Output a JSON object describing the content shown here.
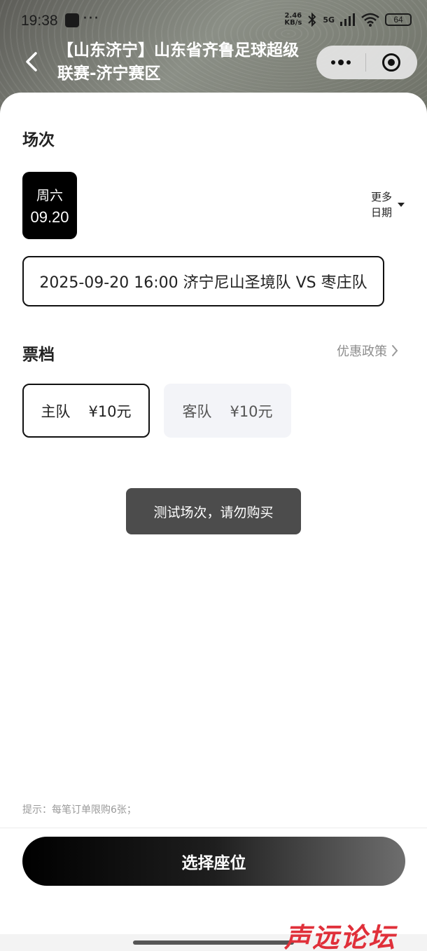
{
  "status_bar": {
    "time": "19:38",
    "more": "···",
    "speed_value": "2.46",
    "speed_unit": "KB/s",
    "network": "5G",
    "battery": "64"
  },
  "nav": {
    "title": "【山东济宁】山东省齐鲁足球超级联赛-济宁赛区",
    "back_icon": "chevron-left-icon",
    "menu_icon": "more-dots-icon",
    "close_icon": "target-icon"
  },
  "session_section": {
    "title": "场次",
    "date_card": {
      "weekday": "周六",
      "date": "09.20"
    },
    "more_dates": {
      "line1": "更多",
      "line2": "日期"
    },
    "session_label": "2025-09-20 16:00 济宁尼山圣境队 VS 枣庄队"
  },
  "ticket_section": {
    "title": "票档",
    "policy_link": "优惠政策",
    "tiers": [
      {
        "name": "主队",
        "price": "¥10元"
      },
      {
        "name": "客队",
        "price": "¥10元"
      }
    ]
  },
  "toast": "测试场次，请勿购买",
  "tip": "提示：每笔订单限购6张；",
  "primary_button": "选择座位",
  "watermark": "声远论坛",
  "colors": {
    "accent": "#000000",
    "toast_bg": "#4c4c4c",
    "muted_text": "#8d8d8d",
    "watermark": "#e0303a"
  }
}
